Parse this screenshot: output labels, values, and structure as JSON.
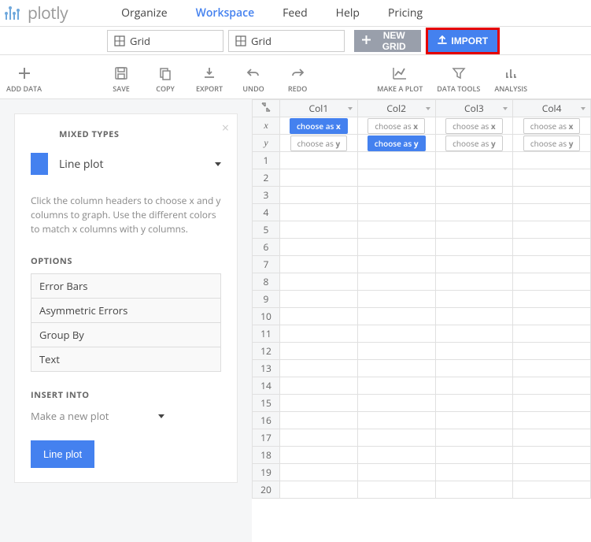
{
  "logo": "plotly",
  "nav": [
    "Organize",
    "Workspace",
    "Feed",
    "Help",
    "Pricing"
  ],
  "nav_active": 1,
  "tabs": [
    "Grid",
    "Grid"
  ],
  "buttons": {
    "new_grid": "NEW GRID",
    "import": "IMPORT"
  },
  "toolbar": [
    "ADD DATA",
    "SAVE",
    "COPY",
    "EXPORT",
    "UNDO",
    "REDO",
    "MAKE A PLOT",
    "DATA TOOLS",
    "ANALYSIS"
  ],
  "panel": {
    "title": "MIXED TYPES",
    "plot_type": "Line plot",
    "hint": "Click the column headers to choose x and y columns to graph. Use the different colors to match x columns with y columns.",
    "options_label": "OPTIONS",
    "options": [
      "Error Bars",
      "Asymmetric Errors",
      "Group By",
      "Text"
    ],
    "insert_label": "INSERT INTO",
    "insert_value": "Make a new plot",
    "action": "Line plot"
  },
  "grid": {
    "columns": [
      "Col1",
      "Col2",
      "Col3",
      "Col4"
    ],
    "axes": [
      "x",
      "y"
    ],
    "choose_x": "choose as x",
    "choose_y": "choose as y",
    "x_selected_col": 0,
    "y_selected_col": 1,
    "row_count": 20
  }
}
